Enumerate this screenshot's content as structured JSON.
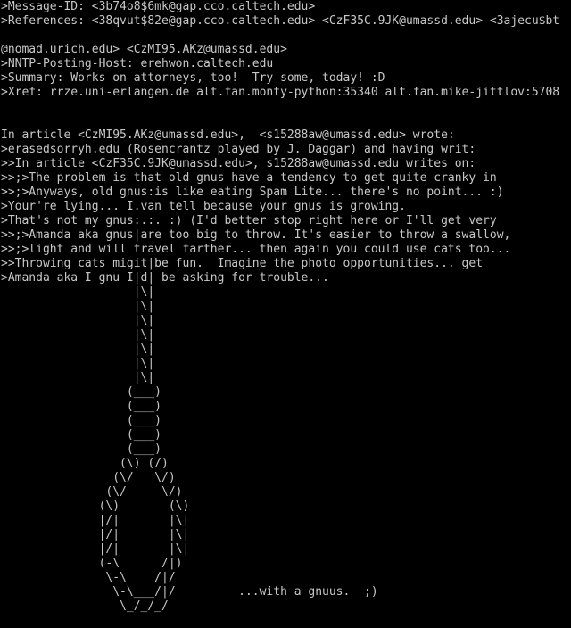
{
  "terminal": {
    "lines": [
      ">Message-ID: <3b74o8$6mk@gap.cco.caltech.edu>",
      ">References: <38qvut$82e@gap.cco.caltech.edu> <CzF35C.9JK@umassd.edu> <3ajecu$bt",
      "",
      "@nomad.urich.edu> <CzMI95.AKz@umassd.edu>",
      ">NNTP-Posting-Host: erehwon.caltech.edu",
      ">Summary: Works on attorneys, too!  Try some, today! :D",
      ">Xref: rrze.uni-erlangen.de alt.fan.monty-python:35340 alt.fan.mike-jittlov:5708",
      "",
      "",
      "In article <CzMI95.AKz@umassd.edu>,  <s15288aw@umassd.edu> wrote:",
      ">erasedsorryh.edu (Rosencrantz played by J. Daggar) and having writ:",
      ">>In article <CzF35C.9JK@umassd.edu>, s15288aw@umassd.edu writes on:",
      ">>;>The problem is that old gnus have a tendency to get quite cranky in",
      ">>;>Anyways, old gnus:is like eating Spam Lite... there's no point... :)",
      ">Your're lying... I.van tell because your gnus is growing.",
      ">That's not my gnus:.:. :) (I'd better stop right here or I'll get very",
      ">>;>Amanda aka gnus|are too big to throw. It's easier to throw a swallow,",
      ">>;>light and will travel farther... then again you could use cats too...",
      ">>Throwing cats migit|be fun.  Imagine the photo opportunities... get",
      ">Amanda aka I gnu I|d| be asking for trouble...",
      "                   |\\|",
      "                   |\\|",
      "                   |\\|",
      "                   |\\|",
      "                   |\\|",
      "                   |\\|",
      "                   |\\|",
      "                  (___)",
      "                  (___)",
      "                  (___)",
      "                  (___)",
      "                  (___)",
      "                 (\\) (/)",
      "                (\\/   \\/)",
      "               (\\/     \\/)",
      "              (\\)       (\\)",
      "              |/|       |\\|",
      "              |/|       |\\|",
      "              |/|       |\\|",
      "              (-\\      /|)",
      "               \\-\\    /|/",
      "                \\-\\___/|/         ...with a gnuus.  ;)",
      "                 \\_/_/_/"
    ]
  }
}
